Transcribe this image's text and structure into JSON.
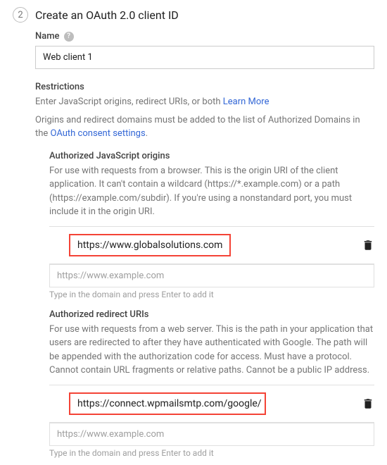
{
  "step_number": "2",
  "title": "Create an OAuth 2.0 client ID",
  "name": {
    "label": "Name",
    "value": "Web client 1"
  },
  "restrictions": {
    "title": "Restrictions",
    "intro": "Enter JavaScript origins, redirect URIs, or both ",
    "learn_more": "Learn More",
    "note_prefix": "Origins and redirect domains must be added to the list of Authorized Domains in the ",
    "note_link": "OAuth consent settings",
    "note_suffix": "."
  },
  "js_origins": {
    "title": "Authorized JavaScript origins",
    "desc": "For use with requests from a browser. This is the origin URI of the client application. It can't contain a wildcard (https://*.example.com) or a path (https://example.com/subdir). If you're using a nonstandard port, you must include it in the origin URI.",
    "value": "https://www.globalsolutions.com",
    "placeholder": "https://www.example.com",
    "hint": "Type in the domain and press Enter to add it"
  },
  "redirect_uris": {
    "title": "Authorized redirect URIs",
    "desc": "For use with requests from a web server. This is the path in your application that users are redirected to after they have authenticated with Google. The path will be appended with the authorization code for access. Must have a protocol. Cannot contain URL fragments or relative paths. Cannot be a public IP address.",
    "value": "https://connect.wpmailsmtp.com/google/",
    "placeholder": "https://www.example.com",
    "hint": "Type in the domain and press Enter to add it"
  }
}
